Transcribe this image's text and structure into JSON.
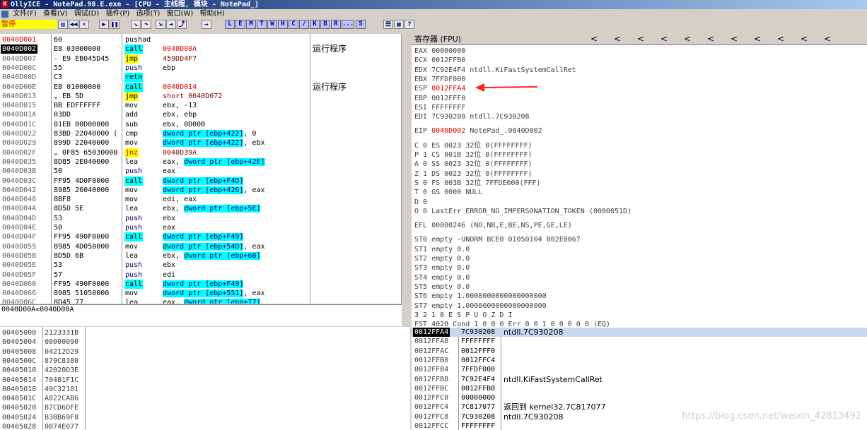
{
  "window": {
    "title": "OllyICE - NotePad.98.E.exe - [CPU - 主线程, 模块 - NotePad_]"
  },
  "menu": [
    "文件(F)",
    "查看(V)",
    "调试(D)",
    "插件(P)",
    "选项(T)",
    "窗口(W)",
    "帮助(H)"
  ],
  "toolbar": {
    "status": "暂停",
    "buttons": [
      "L",
      "E",
      "M",
      "T",
      "W",
      "H",
      "C",
      "/",
      "K",
      "B",
      "R",
      "...",
      "S"
    ]
  },
  "cpu_rows": [
    {
      "addr": "0040D001",
      "hex": "60",
      "mn": "pushad",
      "op": "",
      "cm": "",
      "addr_style": "red"
    },
    {
      "addr": "0040D002",
      "hex": "E8 03000000",
      "mn": "call",
      "op": "0040D00A",
      "cm": "运行程序",
      "addr_style": "sel",
      "mn_style": "call"
    },
    {
      "addr": "0040D007",
      "hex": "- E9 EB045D45",
      "mn": "jmp",
      "op": "459DD4F7",
      "cm": "",
      "mn_style": "jmp"
    },
    {
      "addr": "0040D00C",
      "hex": "55",
      "mn": "push",
      "op": "ebp",
      "cm": "",
      "mn_style": "push"
    },
    {
      "addr": "0040D00D",
      "hex": "C3",
      "mn": "retn",
      "op": "",
      "cm": "",
      "mn_style": "retn"
    },
    {
      "addr": "0040D00E",
      "hex": "E8 01000000",
      "mn": "call",
      "op": "0040D014",
      "cm": "运行程序",
      "mn_style": "call"
    },
    {
      "addr": "0040D013",
      "hex": "⌄ EB 5D",
      "mn": "jmp",
      "op": "short 0040D072",
      "cm": "",
      "mn_style": "jmp"
    },
    {
      "addr": "0040D015",
      "hex": "BB EDFFFFFF",
      "mn": "mov",
      "op": "ebx, -13",
      "cm": ""
    },
    {
      "addr": "0040D01A",
      "hex": "03DD",
      "mn": "add",
      "op": "ebx, ebp",
      "cm": ""
    },
    {
      "addr": "0040D01C",
      "hex": "81EB 00D00000",
      "mn": "sub",
      "op": "ebx, 0D000",
      "cm": ""
    },
    {
      "addr": "0040D022",
      "hex": "83BD 22040000 (",
      "mn": "cmp",
      "op": "dword ptr [ebp+422], 0",
      "cm": ""
    },
    {
      "addr": "0040D029",
      "hex": "899D 22040000",
      "mn": "mov",
      "op": "dword ptr [ebp+422], ebx",
      "cm": ""
    },
    {
      "addr": "0040D02F",
      "hex": "⌄ 0F85 65030000",
      "mn": "jnz",
      "op": "0040D39A",
      "cm": "",
      "mn_style": "jnz"
    },
    {
      "addr": "0040D035",
      "hex": "8D85 2E040000",
      "mn": "lea",
      "op": "eax, dword ptr [ebp+42E]",
      "cm": ""
    },
    {
      "addr": "0040D03B",
      "hex": "50",
      "mn": "push",
      "op": "eax",
      "cm": "",
      "mn_style": "push"
    },
    {
      "addr": "0040D03C",
      "hex": "FF95 4D0F0000",
      "mn": "call",
      "op": "dword ptr [ebp+F4D]",
      "cm": "",
      "mn_style": "call"
    },
    {
      "addr": "0040D042",
      "hex": "8985 26040000",
      "mn": "mov",
      "op": "dword ptr [ebp+426], eax",
      "cm": ""
    },
    {
      "addr": "0040D048",
      "hex": "8BF8",
      "mn": "mov",
      "op": "edi, eax",
      "cm": ""
    },
    {
      "addr": "0040D04A",
      "hex": "8D5D 5E",
      "mn": "lea",
      "op": "ebx, dword ptr [ebp+5E]",
      "cm": ""
    },
    {
      "addr": "0040D04D",
      "hex": "53",
      "mn": "push",
      "op": "ebx",
      "cm": "",
      "mn_style": "push"
    },
    {
      "addr": "0040D04E",
      "hex": "50",
      "mn": "push",
      "op": "eax",
      "cm": "",
      "mn_style": "push"
    },
    {
      "addr": "0040D04F",
      "hex": "FF95 490F0000",
      "mn": "call",
      "op": "dword ptr [ebp+F49]",
      "cm": "",
      "mn_style": "call"
    },
    {
      "addr": "0040D055",
      "hex": "8985 4D050000",
      "mn": "mov",
      "op": "dword ptr [ebp+54D], eax",
      "cm": ""
    },
    {
      "addr": "0040D05B",
      "hex": "8D5D 6B",
      "mn": "lea",
      "op": "ebx, dword ptr [ebp+6B]",
      "cm": ""
    },
    {
      "addr": "0040D05E",
      "hex": "53",
      "mn": "push",
      "op": "ebx",
      "cm": "",
      "mn_style": "push"
    },
    {
      "addr": "0040D05F",
      "hex": "57",
      "mn": "push",
      "op": "edi",
      "cm": "",
      "mn_style": "push"
    },
    {
      "addr": "0040D060",
      "hex": "FF95 490F0000",
      "mn": "call",
      "op": "dword ptr [ebp+F49]",
      "cm": "",
      "mn_style": "call"
    },
    {
      "addr": "0040D066",
      "hex": "8985 51050000",
      "mn": "mov",
      "op": "dword ptr [ebp+551], eax",
      "cm": ""
    },
    {
      "addr": "0040D06C",
      "hex": "8D45 77",
      "mn": "lea",
      "op": "eax, dword ptr [ebp+77]",
      "cm": ""
    }
  ],
  "info_line": "0040D00A=0040D00A",
  "dump_rows": [
    {
      "addr": "00405000",
      "val": "2123331B"
    },
    {
      "addr": "00405004",
      "val": "00000090"
    },
    {
      "addr": "00405008",
      "val": "04212D29"
    },
    {
      "addr": "0040500C",
      "val": "879C8380"
    },
    {
      "addr": "00405010",
      "val": "42020D3E"
    },
    {
      "addr": "00405014",
      "val": "70481F1C"
    },
    {
      "addr": "00405018",
      "val": "49C32181"
    },
    {
      "addr": "0040501C",
      "val": "A022CAB6"
    },
    {
      "addr": "00405020",
      "val": "B7CD6DFE"
    },
    {
      "addr": "00405024",
      "val": "B3BB69F8"
    },
    {
      "addr": "00405028",
      "val": "0074E077"
    }
  ],
  "registers": {
    "header": "寄存器 (FPU)",
    "lines": [
      {
        "t": "EAX 00000000"
      },
      {
        "t": "ECX 0012FFB0"
      },
      {
        "t": "EDX 7C92E4F4 ntdll.KiFastSystemCallRet"
      },
      {
        "t": "EBX 7FFDF000"
      },
      {
        "t": "ESP ",
        "v": "0012FFA4",
        "red": true
      },
      {
        "t": "EBP 0012FFF0"
      },
      {
        "t": "ESI FFFFFFFF"
      },
      {
        "t": "EDI 7C930208 ntdll.7C930208"
      },
      {
        "t": ""
      },
      {
        "t": "EIP ",
        "v": "0040D002",
        "red": true,
        "rest": " NotePad_.0040D002"
      },
      {
        "t": ""
      },
      {
        "t": "C 0  ES 0023 32位 0(FFFFFFFF)"
      },
      {
        "t": "P 1  CS 001B 32位 0(FFFFFFFF)"
      },
      {
        "t": "A 0  SS 0023 32位 0(FFFFFFFF)"
      },
      {
        "t": "Z 1  DS 0023 32位 0(FFFFFFFF)"
      },
      {
        "t": "S 0  FS 003B 32位 7FFDE000(FFF)"
      },
      {
        "t": "T 0  GS 0000 NULL"
      },
      {
        "t": "D 0"
      },
      {
        "t": "O 0  LastErr ERROR_NO_IMPERSONATION_TOKEN (0000051D)"
      },
      {
        "t": ""
      },
      {
        "t": "EFL 00000246 (NO,NB,E,BE,NS,PE,GE,LE)"
      },
      {
        "t": ""
      },
      {
        "t": "ST0 empty -UNORM BCE0 01050104 002E0067"
      },
      {
        "t": "ST1 empty 0.0"
      },
      {
        "t": "ST2 empty 0.0"
      },
      {
        "t": "ST3 empty 0.0"
      },
      {
        "t": "ST4 empty 0.0"
      },
      {
        "t": "ST5 empty 0.0"
      },
      {
        "t": "ST6 empty 1.0000000000000000000"
      },
      {
        "t": "ST7 empty 1.0000000000000000000"
      },
      {
        "t": "                3 2 1 0       E S P U O Z D I"
      },
      {
        "t": "FST 4020  Cond 1 0 0 0  Err 0 0 1 0 0 0 0 0  (EQ)"
      }
    ]
  },
  "stack_rows": [
    {
      "addr": "0012FFA4",
      "val": "7C930208",
      "cm": "ntdll.7C930208",
      "sel": true
    },
    {
      "addr": "0012FFA8",
      "val": "FFFFFFFF",
      "cm": ""
    },
    {
      "addr": "0012FFAC",
      "val": "0012FFF0",
      "cm": ""
    },
    {
      "addr": "0012FFB0",
      "val": "0012FFC4",
      "cm": ""
    },
    {
      "addr": "0012FFB4",
      "val": "7FFDF000",
      "cm": ""
    },
    {
      "addr": "0012FFB8",
      "val": "7C92E4F4",
      "cm": "ntdll.KiFastSystemCallRet"
    },
    {
      "addr": "0012FFBC",
      "val": "0012FFB0",
      "cm": ""
    },
    {
      "addr": "0012FFC0",
      "val": "00000000",
      "cm": ""
    },
    {
      "addr": "0012FFC4",
      "val": "7C817077",
      "cm": "返回到 kernel32.7C817077"
    },
    {
      "addr": "0012FFC8",
      "val": "7C930208",
      "cm": "ntdll.7C930208"
    },
    {
      "addr": "0012FFCC",
      "val": "FFFFFFFF",
      "cm": ""
    }
  ],
  "watermark": "https://blog.csdn.net/weixin_42813492",
  "colors": {
    "title_bar": "#0a246a",
    "status_bg": "#ffff00",
    "call_bg": "#00ffff",
    "jmp_bg": "#ffff00",
    "highlight_red": "#e00000",
    "arrow": "#ff2020"
  }
}
